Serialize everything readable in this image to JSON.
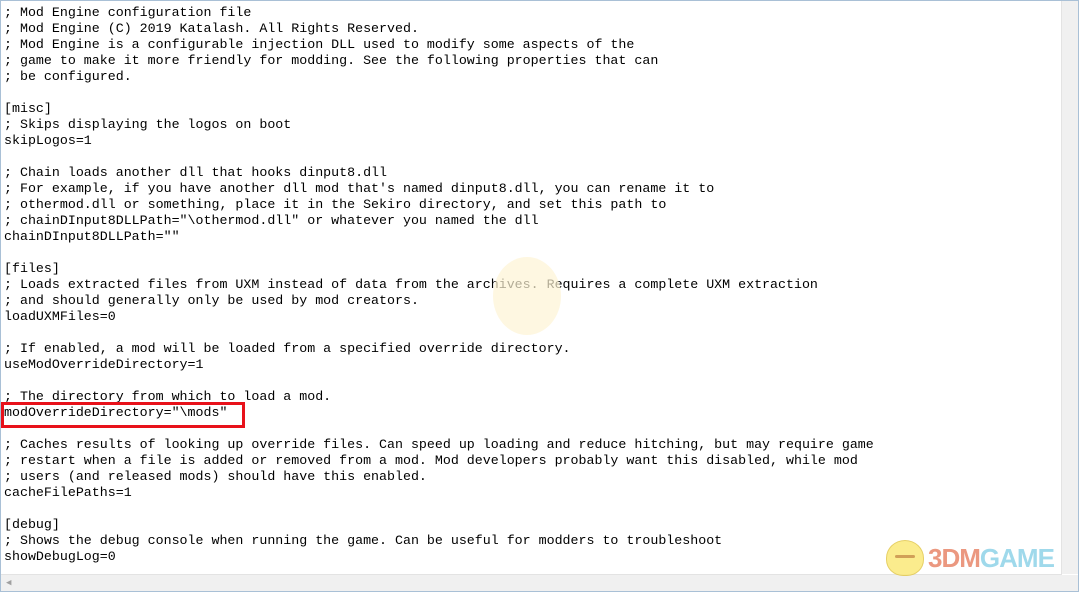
{
  "editor": {
    "lines": [
      "; Mod Engine configuration file",
      "; Mod Engine (C) 2019 Katalash. All Rights Reserved.",
      "; Mod Engine is a configurable injection DLL used to modify some aspects of the",
      "; game to make it more friendly for modding. See the following properties that can",
      "; be configured.",
      "",
      "[misc]",
      "; Skips displaying the logos on boot",
      "skipLogos=1",
      "",
      "; Chain loads another dll that hooks dinput8.dll",
      "; For example, if you have another dll mod that's named dinput8.dll, you can rename it to",
      "; othermod.dll or something, place it in the Sekiro directory, and set this path to",
      "; chainDInput8DLLPath=\"\\othermod.dll\" or whatever you named the dll",
      "chainDInput8DLLPath=\"\"",
      "",
      "[files]",
      "; Loads extracted files from UXM instead of data from the archives. Requires a complete UXM extraction",
      "; and should generally only be used by mod creators.",
      "loadUXMFiles=0",
      "",
      "; If enabled, a mod will be loaded from a specified override directory.",
      "useModOverrideDirectory=1",
      "",
      "; The directory from which to load a mod.",
      "modOverrideDirectory=\"\\mods\"",
      "",
      "; Caches results of looking up override files. Can speed up loading and reduce hitching, but may require game",
      "; restart when a file is added or removed from a mod. Mod developers probably want this disabled, while mod",
      "; users (and released mods) should have this enabled.",
      "cacheFilePaths=1",
      "",
      "[debug]",
      "; Shows the debug console when running the game. Can be useful for modders to troubleshoot",
      "showDebugLog=0"
    ]
  },
  "highlight_color": "#e8111a",
  "watermark": {
    "text_a": "3DM",
    "text_b": "GAME"
  },
  "icons": {
    "scroll_left": "arrow-left-icon"
  }
}
